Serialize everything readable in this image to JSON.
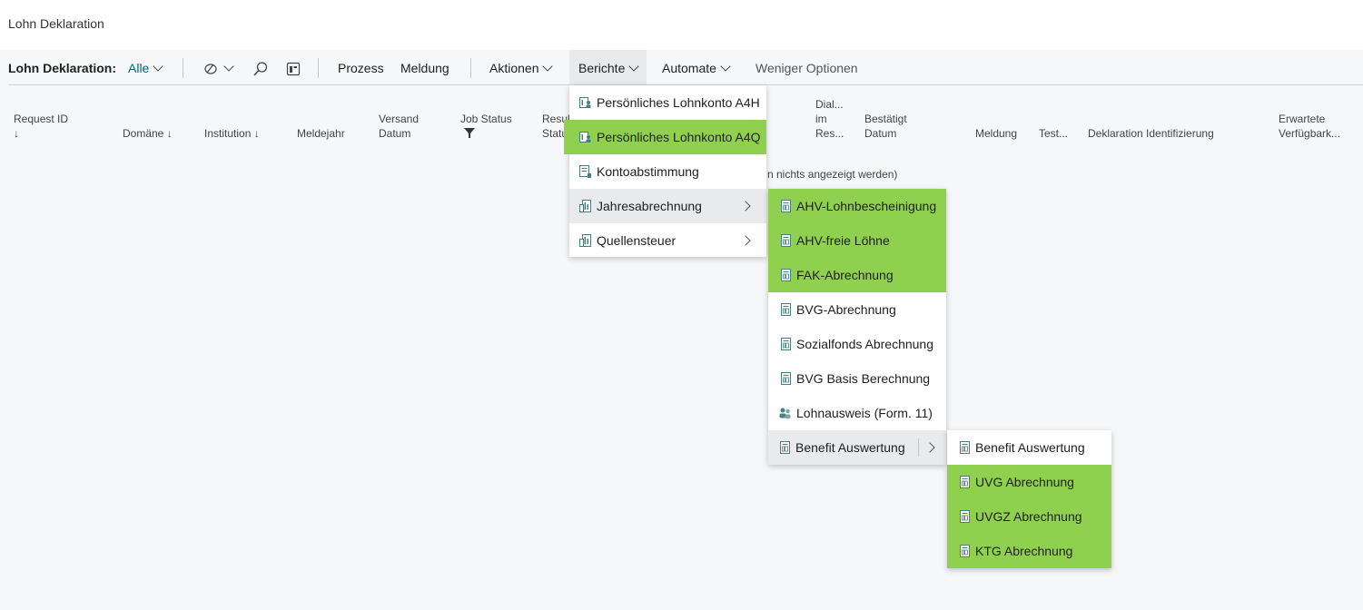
{
  "page": {
    "title": "Lohn Deklaration"
  },
  "actionbar": {
    "view_label": "Lohn Deklaration:",
    "filter_value": "Alle",
    "prozess": "Prozess",
    "meldung": "Meldung",
    "aktionen": "Aktionen",
    "berichte": "Berichte",
    "automate": "Automate",
    "weniger": "Weniger Optionen"
  },
  "columns": {
    "request_id": "Request ID",
    "domaene": "Domäne",
    "institution": "Institution",
    "meldejahr": "Meldejahr",
    "versand_1": "Versand",
    "versand_2": "Datum",
    "job_status": "Job Status",
    "result_1": "Resul",
    "result_2": "Statu",
    "dial_1": "Dial...",
    "dial_2": "im",
    "dial_3": "Res...",
    "bestaetigt_1": "Bestätigt",
    "bestaetigt_2": "Datum",
    "meldung": "Meldung",
    "test": "Test...",
    "deklaration": "Deklaration Identifizierung",
    "erwartete_1": "Erwartete",
    "erwartete_2": "Verfügbark...",
    "sort_arrow": "↓"
  },
  "empty_text": "n nichts angezeigt werden)",
  "berichte_menu": [
    {
      "label": "Persönliches Lohnkonto A4H",
      "icon": "report-person-icon"
    },
    {
      "label": "Persönliches Lohnkonto A4Q",
      "icon": "report-person-icon"
    },
    {
      "label": "Kontoabstimmung",
      "icon": "report-icon"
    },
    {
      "label": "Jahresabrechnung",
      "icon": "building-report-icon"
    },
    {
      "label": "Quellensteuer",
      "icon": "building-report-icon"
    }
  ],
  "jahresabrechnung_menu": [
    {
      "label": "AHV-Lohnbescheinigung",
      "icon": "document-icon"
    },
    {
      "label": "AHV-freie Löhne",
      "icon": "document-icon"
    },
    {
      "label": "FAK-Abrechnung",
      "icon": "document-icon"
    },
    {
      "label": "BVG-Abrechnung",
      "icon": "document-icon"
    },
    {
      "label": "Sozialfonds Abrechnung",
      "icon": "document-icon"
    },
    {
      "label": "BVG Basis Berechnung",
      "icon": "document-icon"
    },
    {
      "label": "Lohnausweis (Form. 11)",
      "icon": "people-icon"
    },
    {
      "label": "Benefit Auswertung",
      "icon": "document-icon"
    }
  ],
  "benefit_menu": [
    {
      "label": "Benefit Auswertung",
      "icon": "document-icon"
    },
    {
      "label": "UVG Abrechnung",
      "icon": "document-icon"
    },
    {
      "label": "UVGZ Abrechnung",
      "icon": "document-icon"
    },
    {
      "label": "KTG Abrechnung",
      "icon": "document-icon"
    }
  ],
  "colors": {
    "highlight": "#8fd14f",
    "accent": "#006b77",
    "hover": "#e8eaec"
  }
}
